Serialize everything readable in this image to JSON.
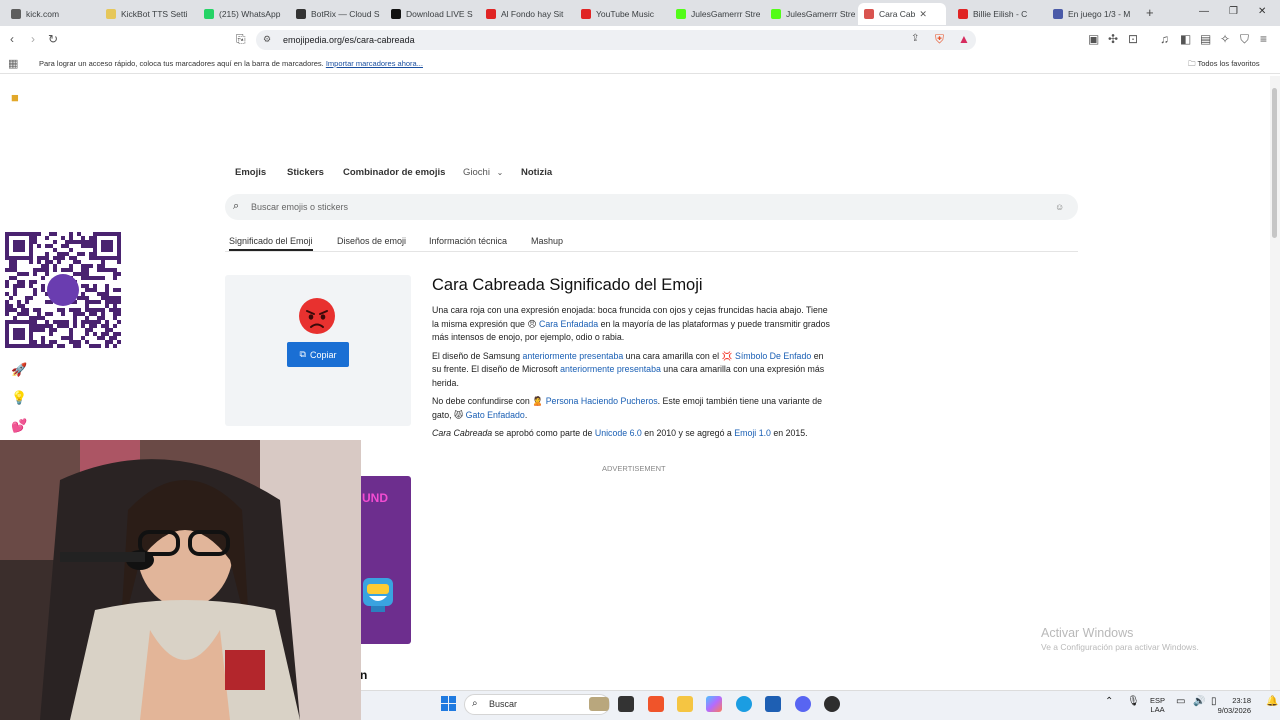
{
  "browser": {
    "tabs": [
      {
        "title": "kick.com",
        "color": "#5d5d5d"
      },
      {
        "title": "KickBot TTS Setti",
        "color": "#e6c75a"
      },
      {
        "title": "(215) WhatsApp",
        "color": "#25d366"
      },
      {
        "title": "BotRix — Cloud S",
        "color": "#333333"
      },
      {
        "title": "Download LIVE S",
        "color": "#111111"
      },
      {
        "title": "Al Fondo hay Sit",
        "color": "#e02424"
      },
      {
        "title": "YouTube Music",
        "color": "#e02424"
      },
      {
        "title": "JulesGamerrr Stre",
        "color": "#53fc18"
      },
      {
        "title": "JulesGamerrr Stre",
        "color": "#53fc18"
      },
      {
        "title": "Cara Cab",
        "color": "#d9534f"
      },
      {
        "title": "Billie Eilish - C",
        "color": "#e02424"
      },
      {
        "title": "En juego 1/3 - M",
        "color": "#4a5aa8"
      }
    ],
    "url": "emojipedia.org/es/cara-cabreada",
    "bookmarks_message": "Para lograr un acceso rápido, coloca tus marcadores aquí en la barra de marcadores.",
    "import_link": "Importar marcadores ahora...",
    "all_favorites": "Todos los favoritos"
  },
  "nav": {
    "items": [
      "Emojis",
      "Stickers",
      "Combinador de emojis",
      "Giochi",
      "Notizia"
    ]
  },
  "search": {
    "placeholder": "Buscar emojis o stickers"
  },
  "subtabs": [
    "Significado del Emoji",
    "Diseños de emoji",
    "Información técnica",
    "Mashup"
  ],
  "emoji_card": {
    "copy_label": "Copiar"
  },
  "article": {
    "title": "Cara Cabreada Significado del Emoji",
    "p1a": "Una cara roja con una expresión enojada: boca fruncida con ojos y cejas fruncidas hacia abajo. Tiene la misma expresión que ",
    "p1_link": "Cara Enfadada",
    "p1b": " en la mayoría de las plataformas y puede transmitir grados más intensos de enojo, por ejemplo, odio o rabia.",
    "p2a": "El diseño de Samsung ",
    "p2_link1": "anteriormente presentaba",
    "p2b": " una cara amarilla con el ",
    "p2_link2": "Símbolo De Enfado",
    "p2c": " en su frente. El diseño de Microsoft ",
    "p2_link3": "anteriormente presentaba",
    "p2d": " una cara amarilla con una expresión más herida.",
    "p3a": "No debe confundirse con ",
    "p3_link1": "Persona Haciendo Pucheros",
    "p3b": ". Este emoji también tiene una variante de gato, ",
    "p3_link2": "Gato Enfadado",
    "p3c": ".",
    "p4_italic": "Cara Cabreada",
    "p4a": " se aprobó como parte de ",
    "p4_link1": "Unicode 6.0",
    "p4b": " en 2010 y se agregó a ",
    "p4_link2": "Emoji 1.0",
    "p4c": " en 2015.",
    "ad_label": "ADVERTISEMENT"
  },
  "ad": {
    "text": "UND"
  },
  "bottom_fragment": "n",
  "windows": {
    "activate_title": "Activar Windows",
    "activate_sub": "Ve a Configuración para activar Windows."
  },
  "taskbar": {
    "search": "Buscar",
    "lang1": "ESP",
    "lang2": "LAA",
    "time": "23:18",
    "date": "9/03/2026"
  }
}
